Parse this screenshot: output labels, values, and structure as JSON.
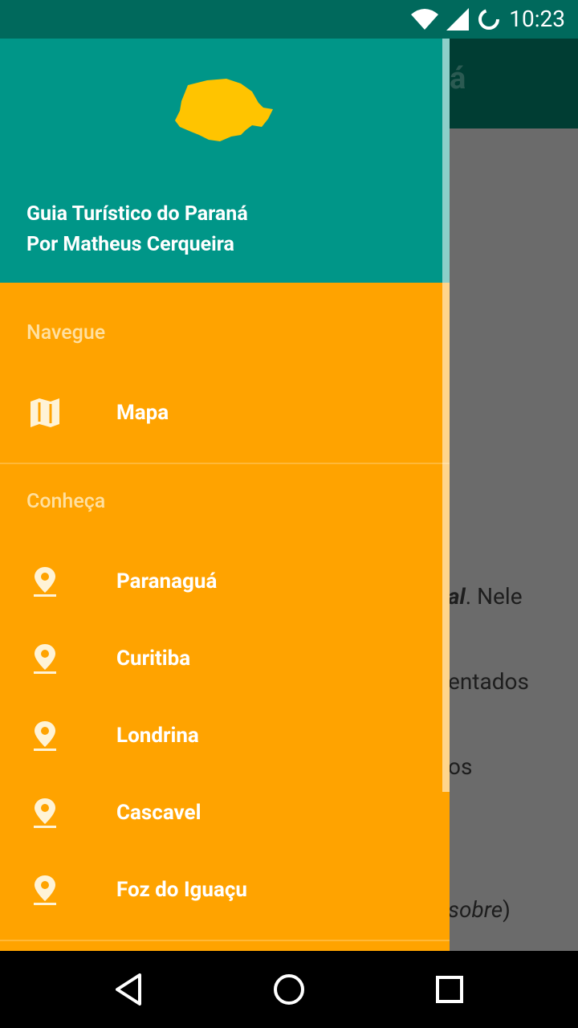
{
  "status_bar": {
    "time": "10:23"
  },
  "background": {
    "toolbar_title_fragment": "á",
    "lines": [
      {
        "bold_italic": "al",
        "text": ". Nele"
      },
      {
        "text": "entados"
      },
      {
        "text": "os"
      },
      {
        "italic": "sobre",
        "text": ")"
      }
    ]
  },
  "drawer": {
    "header": {
      "title": "Guia Turístico do Paraná",
      "subtitle": "Por Matheus Cerqueira"
    },
    "sections": [
      {
        "header": "Navegue",
        "items": [
          {
            "label": "Mapa",
            "icon": "map-icon"
          }
        ]
      },
      {
        "header": "Conheça",
        "items": [
          {
            "label": "Paranaguá",
            "icon": "place-icon"
          },
          {
            "label": "Curitiba",
            "icon": "place-icon"
          },
          {
            "label": "Londrina",
            "icon": "place-icon"
          },
          {
            "label": "Cascavel",
            "icon": "place-icon"
          },
          {
            "label": "Foz do Iguaçu",
            "icon": "place-icon"
          }
        ]
      }
    ]
  },
  "colors": {
    "header": "#009688",
    "drawer": "#ffa300",
    "logo": "#ffc400",
    "section_text": "#ffe0a0"
  }
}
